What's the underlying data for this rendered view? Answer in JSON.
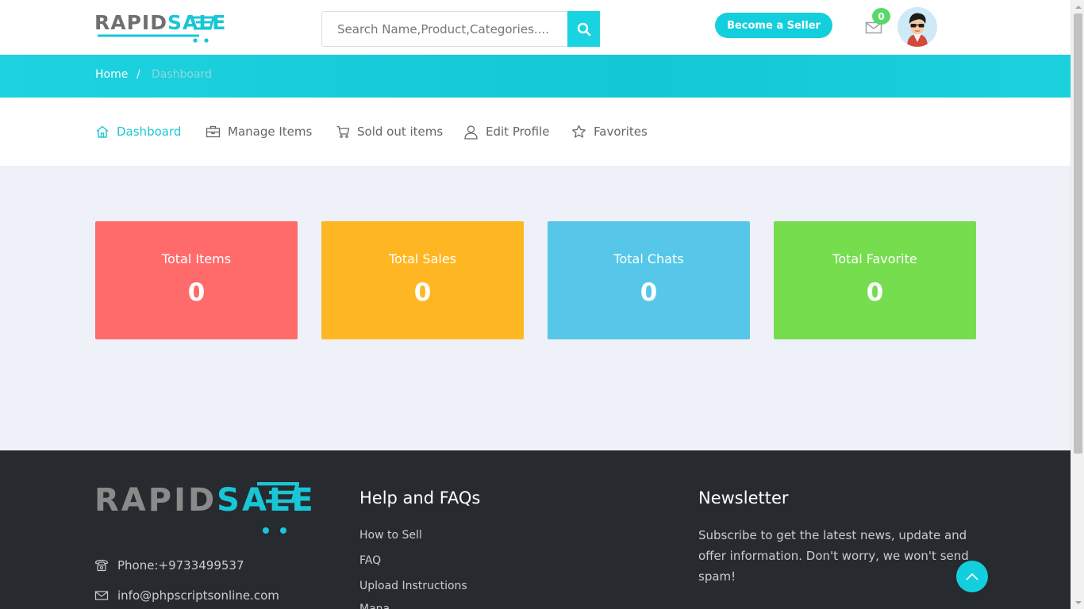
{
  "brand": {
    "part1": "RAPID",
    "part2": "SALE"
  },
  "header": {
    "search_placeholder": "Search Name,Product,Categories....",
    "seller_button": "Become a Seller",
    "mail_badge": "0"
  },
  "breadcrumb": {
    "home": "Home",
    "separator": "/",
    "current": "Dashboard"
  },
  "nav": {
    "items": [
      {
        "label": "Dashboard",
        "icon": "home-icon",
        "active": true
      },
      {
        "label": "Manage Items",
        "icon": "briefcase-icon",
        "active": false
      },
      {
        "label": "Sold out items",
        "icon": "cart-icon",
        "active": false
      },
      {
        "label": "Edit Profile",
        "icon": "user-icon",
        "active": false
      },
      {
        "label": "Favorites",
        "icon": "star-icon",
        "active": false
      }
    ]
  },
  "stats": [
    {
      "label": "Total Items",
      "value": "0",
      "color": "#ff6b6b"
    },
    {
      "label": "Total Sales",
      "value": "0",
      "color": "#feb723"
    },
    {
      "label": "Total Chats",
      "value": "0",
      "color": "#56c7e8"
    },
    {
      "label": "Total Favorite",
      "value": "0",
      "color": "#76dd4e"
    }
  ],
  "footer": {
    "phone": "Phone:+9733499537",
    "email": "info@phpscriptsonline.com",
    "help_title": "Help and FAQs",
    "help_links": [
      "How to Sell",
      "FAQ",
      "Upload Instructions",
      "Mana..."
    ],
    "newsletter_title": "Newsletter",
    "newsletter_text": "Subscribe to get the latest news, update and offer information. Don't worry, we won't send spam!"
  },
  "colors": {
    "accent": "#19c6d6",
    "footer_bg": "#272a2f",
    "page_bg": "#eef1f7"
  }
}
